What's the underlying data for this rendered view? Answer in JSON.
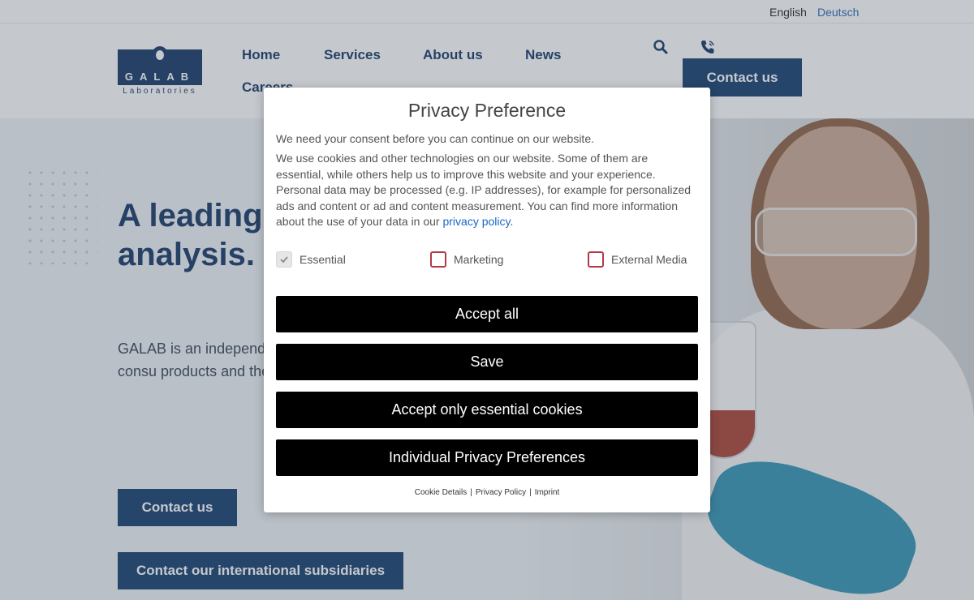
{
  "site": {
    "languages": [
      "English",
      "Deutsch"
    ],
    "logo": {
      "name": "GALAB",
      "tagline": "Laboratories"
    },
    "nav": [
      "Home",
      "Services",
      "About us",
      "News",
      "Careers"
    ],
    "header_cta": "Contact us",
    "hero": {
      "title": "A leading field of lab analysis.",
      "text": "GALAB is an independ external quality control food packaging, consu products and their raw contaminants."
    },
    "buttons": {
      "contact": "Contact us",
      "subsidiaries": "Contact our international subsidiaries"
    }
  },
  "modal": {
    "title": "Privacy Preference",
    "intro": "We need your consent before you can continue on our website.",
    "body": "We use cookies and other technologies on our website. Some of them are essential, while others help us to improve this website and your experience. Personal data may be processed (e.g. IP addresses), for example for personalized ads and content or ad and content measurement. You can find more information about the use of your data in our",
    "body_link": "privacy policy",
    "body_end": ".",
    "checkboxes": [
      {
        "label": "Essential",
        "checked": true,
        "disabled": true
      },
      {
        "label": "Marketing",
        "checked": false
      },
      {
        "label": "External Media",
        "checked": false
      }
    ],
    "buttons": [
      "Accept all",
      "Save",
      "Accept only essential cookies",
      "Individual Privacy Preferences"
    ],
    "footer_links": [
      "Cookie Details",
      "Privacy Policy",
      "Imprint"
    ],
    "footer_sep": "|"
  },
  "colors": {
    "brand": "#0b3566",
    "button": "#000000",
    "checkbox_border": "#b23a48",
    "link": "#1a66c4"
  }
}
